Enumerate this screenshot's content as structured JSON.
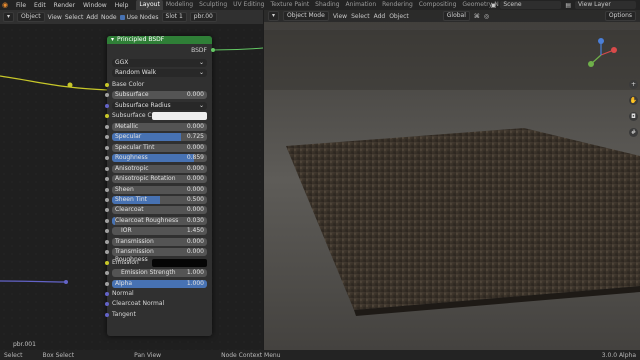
{
  "menu": [
    "File",
    "Edit",
    "Render",
    "Window",
    "Help"
  ],
  "tabs": [
    "Layout",
    "Modeling",
    "Sculpting",
    "UV Editing",
    "Texture Paint",
    "Shading",
    "Animation",
    "Rendering",
    "Compositing",
    "Geometry N"
  ],
  "active_tab": "Layout",
  "scene": "Scene",
  "view_layer": "View Layer",
  "node_editor": {
    "mode": "Object",
    "view": "View",
    "select": "Select",
    "add": "Add",
    "node": "Node",
    "use_nodes": "Use Nodes",
    "slot": "Slot 1",
    "material": "pbr.00",
    "footer_label": "pbr.001"
  },
  "node": {
    "title": "Principled BSDF",
    "output": "BSDF",
    "distribution": "GGX",
    "subsurface_method": "Random Walk",
    "inputs": [
      {
        "label": "Base Color",
        "type": "label",
        "socket": "yellow"
      },
      {
        "label": "Subsurface",
        "value": "0.000",
        "fill": 0,
        "socket": "grey"
      },
      {
        "label": "Subsurface Radius",
        "type": "select",
        "socket": "purple"
      },
      {
        "label": "Subsurface Co...",
        "type": "color",
        "socket": "yellow"
      },
      {
        "label": "Metallic",
        "value": "0.000",
        "fill": 0,
        "socket": "grey"
      },
      {
        "label": "Specular",
        "value": "0.725",
        "fill": 0.725,
        "socket": "grey"
      },
      {
        "label": "Specular Tint",
        "value": "0.000",
        "fill": 0,
        "socket": "grey"
      },
      {
        "label": "Roughness",
        "value": "0.859",
        "fill": 0.859,
        "socket": "grey"
      },
      {
        "label": "Anisotropic",
        "value": "0.000",
        "fill": 0,
        "socket": "grey"
      },
      {
        "label": "Anisotropic Rotation",
        "value": "0.000",
        "fill": 0,
        "socket": "grey"
      },
      {
        "label": "Sheen",
        "value": "0.000",
        "fill": 0,
        "socket": "grey"
      },
      {
        "label": "Sheen Tint",
        "value": "0.500",
        "fill": 0.5,
        "socket": "grey"
      },
      {
        "label": "Clearcoat",
        "value": "0.000",
        "fill": 0,
        "socket": "grey"
      },
      {
        "label": "Clearcoat Roughness",
        "value": "0.030",
        "fill": 0.03,
        "socket": "grey"
      },
      {
        "label": "IOR",
        "value": "1.450",
        "fill": 0,
        "socket": "grey"
      },
      {
        "label": "Transmission",
        "value": "0.000",
        "fill": 0,
        "socket": "grey"
      },
      {
        "label": "Transmission Roughness",
        "value": "0.000",
        "fill": 0,
        "socket": "grey"
      },
      {
        "label": "Emission",
        "type": "color_black",
        "socket": "yellow"
      },
      {
        "label": "Emission Strength",
        "value": "1.000",
        "fill": 0,
        "socket": "grey"
      },
      {
        "label": "Alpha",
        "value": "1.000",
        "fill": 1,
        "socket": "grey"
      },
      {
        "label": "Normal",
        "type": "label",
        "socket": "purple"
      },
      {
        "label": "Clearcoat Normal",
        "type": "label",
        "socket": "purple"
      },
      {
        "label": "Tangent",
        "type": "label",
        "socket": "purple"
      }
    ]
  },
  "viewport": {
    "mode": "Object Mode",
    "view": "View",
    "select": "Select",
    "add": "Add",
    "object": "Object",
    "transform": "Global",
    "options": "Options"
  },
  "status": {
    "select": "Select",
    "box_select": "Box Select",
    "pan_view": "Pan View",
    "context_menu": "Node Context Menu",
    "version": "3.0.0 Alpha"
  },
  "colors": {
    "accent": "#4772b3",
    "node_header": "#2f7f37",
    "socket_yellow": "#c7c729",
    "socket_purple": "#6363c7"
  }
}
